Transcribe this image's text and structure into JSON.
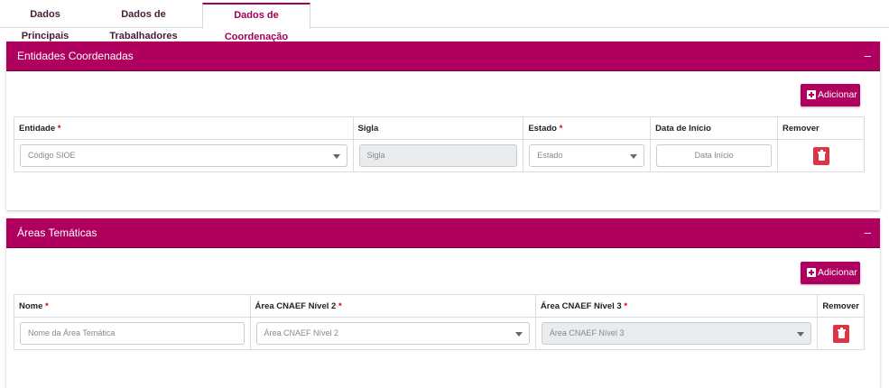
{
  "tabs": [
    {
      "label": "Dados Principais"
    },
    {
      "label": "Dados de Trabalhadores"
    },
    {
      "label": "Dados de Coordenação",
      "active": true
    }
  ],
  "colors": {
    "accent": "#b0005f",
    "danger": "#dc3545"
  },
  "panels": {
    "entidades": {
      "title": "Entidades Coordenadas",
      "collapse": "–",
      "add_label": "Adicionar",
      "columns": {
        "entidade": "Entidade",
        "sigla": "Sigla",
        "estado": "Estado",
        "data_inicio": "Data de Início",
        "remover": "Remover"
      },
      "required_mark": "*",
      "row": {
        "entidade_placeholder": "Código SIOE",
        "sigla_placeholder": "Sigla",
        "estado_placeholder": "Estado",
        "data_placeholder": "Data Início"
      }
    },
    "areas": {
      "title": "Áreas Temáticas",
      "collapse": "–",
      "add_label": "Adicionar",
      "columns": {
        "nome": "Nome",
        "nivel2": "Área CNAEF Nível 2",
        "nivel3": "Área CNAEF Nível 3",
        "remover": "Remover"
      },
      "required_mark": "*",
      "row": {
        "nome_placeholder": "Nome da Área Temática",
        "nivel2_placeholder": "Área CNAEF Nível 2",
        "nivel3_placeholder": "Área CNAEF Nível 3"
      }
    }
  }
}
